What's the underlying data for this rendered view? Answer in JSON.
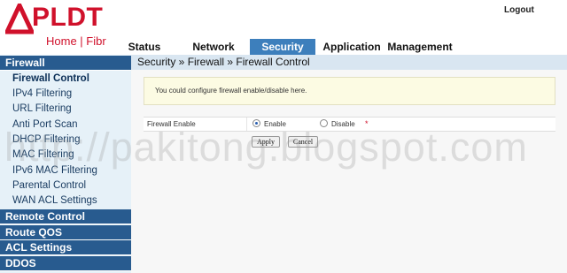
{
  "brand": {
    "name": "PLDT",
    "sub": "Home | Fibr",
    "color": "#d0112b"
  },
  "header": {
    "logout": "Logout"
  },
  "topnav": {
    "tabs": [
      {
        "label": "Status"
      },
      {
        "label": "Network"
      },
      {
        "label": "Security",
        "active": true
      },
      {
        "label": "Application"
      },
      {
        "label": "Management"
      }
    ]
  },
  "sidebar": {
    "section_firewall": "Firewall",
    "items": [
      {
        "label": "Firewall Control",
        "active": true
      },
      {
        "label": "IPv4 Filtering"
      },
      {
        "label": "URL Filtering"
      },
      {
        "label": "Anti Port Scan"
      },
      {
        "label": "DHCP Filtering"
      },
      {
        "label": "MAC Filtering"
      },
      {
        "label": "IPv6 MAC Filtering"
      },
      {
        "label": "Parental Control"
      },
      {
        "label": "WAN ACL Settings"
      }
    ],
    "sections": [
      {
        "label": "Remote Control"
      },
      {
        "label": "Route QOS"
      },
      {
        "label": "ACL Settings"
      },
      {
        "label": "DDOS"
      }
    ]
  },
  "breadcrumb": "Security » Firewall » Firewall Control",
  "info": "You could configure firewall enable/disable here.",
  "form": {
    "label": "Firewall Enable",
    "options": [
      {
        "label": "Enable",
        "selected": true
      },
      {
        "label": "Disable",
        "selected": false
      }
    ],
    "required": "*"
  },
  "buttons": {
    "apply": "Apply",
    "cancel": "Cancel"
  },
  "watermark": "http://pakitong.blogspot.com",
  "colors": {
    "nav_active": "#3d7fbc",
    "sidebar_header": "#285b8f",
    "sidebar_bg": "#e6f1f8"
  }
}
